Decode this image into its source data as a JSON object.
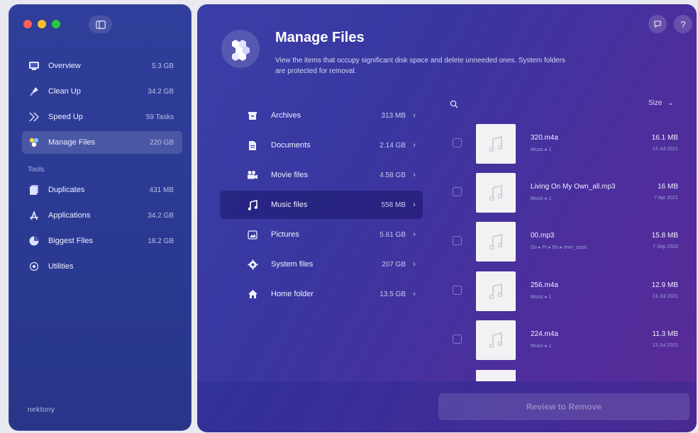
{
  "sidebar": {
    "items": [
      {
        "label": "Overview",
        "value": "5.3 GB",
        "icon": "overview-icon"
      },
      {
        "label": "Clean Up",
        "value": "34.2 GB",
        "icon": "broom-icon"
      },
      {
        "label": "Speed Up",
        "value": "59 Tasks",
        "icon": "speed-icon"
      },
      {
        "label": "Manage Files",
        "value": "220 GB",
        "icon": "manage-files-icon"
      }
    ],
    "section_label": "Tools",
    "tools": [
      {
        "label": "Duplicates",
        "value": "431 MB",
        "icon": "duplicates-icon"
      },
      {
        "label": "Applications",
        "value": "34.2 GB",
        "icon": "applications-icon"
      },
      {
        "label": "Biggest Files",
        "value": "18.2 GB",
        "icon": "pie-chart-icon"
      },
      {
        "label": "Utilities",
        "value": "",
        "icon": "utilities-icon"
      }
    ],
    "brand": "nektony"
  },
  "header": {
    "title": "Manage Files",
    "description": "View the items that occupy significant disk space and delete unneeded ones. System folders are protected for removal."
  },
  "top_icons": {
    "feedback": "💬",
    "help": "?"
  },
  "categories": [
    {
      "label": "Archives",
      "value": "313 MB",
      "icon": "archive-icon"
    },
    {
      "label": "Documents",
      "value": "2.14 GB",
      "icon": "document-icon"
    },
    {
      "label": "Movie files",
      "value": "4.58 GB",
      "icon": "movie-icon"
    },
    {
      "label": "Music files",
      "value": "558 MB",
      "icon": "music-icon"
    },
    {
      "label": "Pictures",
      "value": "5.61 GB",
      "icon": "picture-icon"
    },
    {
      "label": "System files",
      "value": "207 GB",
      "icon": "gear-icon"
    },
    {
      "label": "Home folder",
      "value": "13.5 GB",
      "icon": "home-icon"
    }
  ],
  "file_list": {
    "sort_label": "Size",
    "files": [
      {
        "name": "320.m4a",
        "path": "Music ▸ 1",
        "size": "16.1 MB",
        "date": "13 Jul 2021"
      },
      {
        "name": "Living On My Own_all.mp3",
        "path": "Music ▸ 1",
        "size": "16 MB",
        "date": "7 Apr 2021"
      },
      {
        "name": "00.mp3",
        "path": "Do ▸ Pr ▸ Bu ▸ mvn_sasic",
        "size": "15.8 MB",
        "date": "7 Sep 2020"
      },
      {
        "name": "256.m4a",
        "path": "Music ▸ 1",
        "size": "12.9 MB",
        "date": "13 Jul 2021"
      },
      {
        "name": "224.m4a",
        "path": "Music ▸ 1",
        "size": "11.3 MB",
        "date": "13 Jul 2021"
      }
    ]
  },
  "footer": {
    "review_label": "Review to Remove"
  }
}
